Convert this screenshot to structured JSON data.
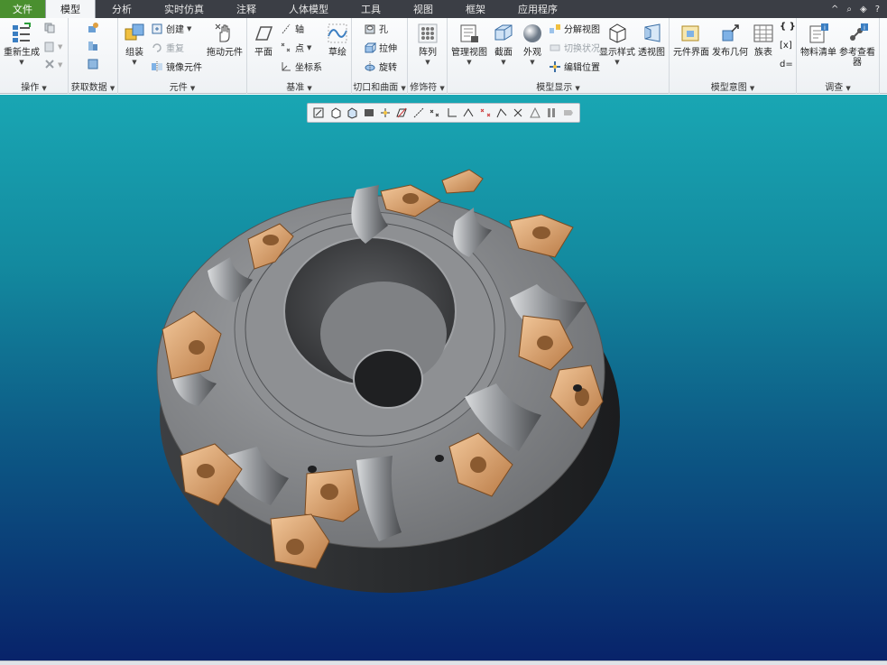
{
  "menu": {
    "file": "文件",
    "tabs": [
      "模型",
      "分析",
      "实时仿真",
      "注释",
      "人体模型",
      "工具",
      "视图",
      "框架",
      "应用程序"
    ],
    "active_index": 0,
    "quick_access": [
      "^",
      "⌕",
      "◈",
      "?"
    ]
  },
  "ribbon": {
    "operations": {
      "label": "操作",
      "regen": "重新生成"
    },
    "get_data": {
      "label": "获取数据"
    },
    "component": {
      "label": "元件",
      "assemble": "组装",
      "create": "创建",
      "repeat": "重复",
      "mirror": "镜像元件",
      "drag": "拖动元件"
    },
    "datum": {
      "label": "基准",
      "plane": "平面",
      "axis": "轴",
      "point": "点",
      "csys": "坐标系",
      "sketch": "草绘"
    },
    "cut_surface": {
      "label": "切口和曲面",
      "hole": "孔",
      "extrude": "拉伸",
      "revolve": "旋转"
    },
    "modifiers": {
      "label": "修饰符",
      "pattern": "阵列"
    },
    "model_display": {
      "label": "模型显示",
      "manage_views": "管理视图",
      "section": "截面",
      "appearance": "外观",
      "explode": "分解视图",
      "toggle_status": "切换状况",
      "edit_position": "编辑位置",
      "display_style": "显示样式",
      "perspective": "透视图"
    },
    "model_intent": {
      "label": "模型意图",
      "comp_interface": "元件界面",
      "publish_geom": "发布几何",
      "family_table": "族表",
      "relations_a": "{ }",
      "relations_b": "[x]",
      "relations_c": "d="
    },
    "investigate": {
      "label": "调查",
      "bom": "物料清单",
      "ref_viewer": "参考查看器"
    }
  },
  "colors": {
    "menubar": "#3b3e45",
    "file_tab": "#4a8f2f",
    "insert": "#d6955a",
    "body": "#8d8f92",
    "viewport_top": "#19a6b3",
    "viewport_bottom": "#08236a"
  }
}
